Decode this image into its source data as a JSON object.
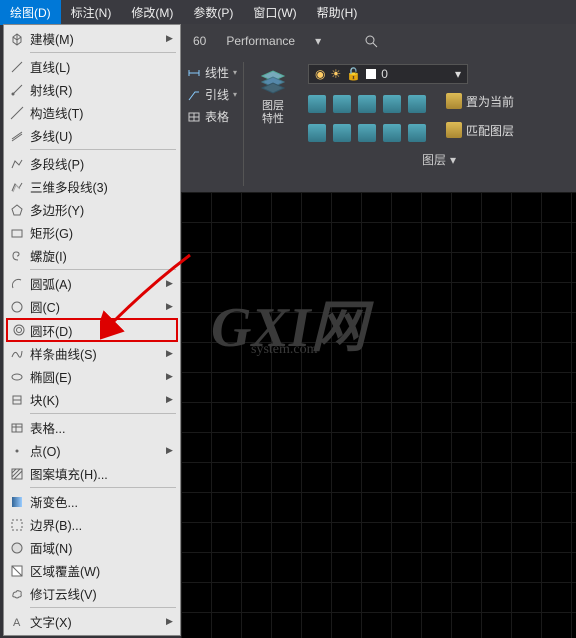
{
  "menubar": {
    "items": [
      {
        "label": "绘图(D)",
        "active": true
      },
      {
        "label": "标注(N)"
      },
      {
        "label": "修改(M)"
      },
      {
        "label": "参数(P)"
      },
      {
        "label": "窗口(W)"
      },
      {
        "label": "帮助(H)"
      }
    ]
  },
  "dropdown": {
    "groups": [
      [
        {
          "icon": "cube",
          "label": "建模(M)",
          "sub": true
        }
      ],
      [
        {
          "icon": "line",
          "label": "直线(L)"
        },
        {
          "icon": "ray",
          "label": "射线(R)"
        },
        {
          "icon": "xline",
          "label": "构造线(T)"
        },
        {
          "icon": "multi",
          "label": "多线(U)"
        }
      ],
      [
        {
          "icon": "pline",
          "label": "多段线(P)"
        },
        {
          "icon": "pline3d",
          "label": "三维多段线(3)"
        },
        {
          "icon": "polygon",
          "label": "多边形(Y)"
        },
        {
          "icon": "rect",
          "label": "矩形(G)"
        },
        {
          "icon": "spiral",
          "label": "螺旋(I)"
        }
      ],
      [
        {
          "icon": "arc",
          "label": "圆弧(A)",
          "sub": true
        },
        {
          "icon": "circle",
          "label": "圆(C)",
          "sub": true
        },
        {
          "icon": "donut",
          "label": "圆环(D)",
          "highlight": true
        },
        {
          "icon": "spline",
          "label": "样条曲线(S)",
          "sub": true
        },
        {
          "icon": "ellipse",
          "label": "椭圆(E)",
          "sub": true
        },
        {
          "icon": "block",
          "label": "块(K)",
          "sub": true
        }
      ],
      [
        {
          "icon": "table",
          "label": "表格..."
        },
        {
          "icon": "point",
          "label": "点(O)",
          "sub": true
        },
        {
          "icon": "hatch",
          "label": "图案填充(H)..."
        }
      ],
      [
        {
          "icon": "gradient",
          "label": "渐变色..."
        },
        {
          "icon": "boundary",
          "label": "边界(B)..."
        },
        {
          "icon": "region",
          "label": "面域(N)"
        },
        {
          "icon": "wipeout",
          "label": "区域覆盖(W)"
        },
        {
          "icon": "revcloud",
          "label": "修订云线(V)"
        }
      ],
      [
        {
          "icon": "text",
          "label": "文字(X)",
          "sub": true
        }
      ]
    ]
  },
  "ribbon": {
    "tab_partial": "60",
    "tab_perf": "Performance",
    "col1": {
      "btn1": "线性",
      "btn2": "引线",
      "btn3": "表格"
    },
    "layer_panel_big": "图层\n特性",
    "layer_value": "0",
    "layer_set_current": "置为当前",
    "layer_match": "匹配图层",
    "footer": "图层"
  },
  "watermark": {
    "big": "GXI网",
    "small": "system.com"
  }
}
